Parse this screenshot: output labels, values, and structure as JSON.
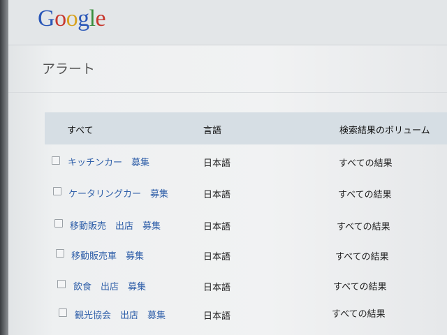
{
  "brand": {
    "logo_letters": [
      "G",
      "o",
      "o",
      "g",
      "l",
      "e"
    ]
  },
  "page": {
    "title": "アラート"
  },
  "table": {
    "headers": {
      "all": "すべて",
      "language": "言語",
      "volume": "検索結果のボリューム"
    },
    "rows": [
      {
        "name": "キッチンカー　募集",
        "language": "日本語",
        "volume": "すべての結果"
      },
      {
        "name": "ケータリングカー　募集",
        "language": "日本語",
        "volume": "すべての結果"
      },
      {
        "name": "移動販売　出店　募集",
        "language": "日本語",
        "volume": "すべての結果"
      },
      {
        "name": "移動販売車　募集",
        "language": "日本語",
        "volume": "すべての結果"
      },
      {
        "name": "飲食　出店　募集",
        "language": "日本語",
        "volume": "すべての結果"
      },
      {
        "name": "観光協会　出店　募集",
        "language": "日本語",
        "volume": "すべての結果"
      }
    ]
  },
  "colors": {
    "link": "#2f5fa9",
    "header_bg": "#d6dee4"
  }
}
